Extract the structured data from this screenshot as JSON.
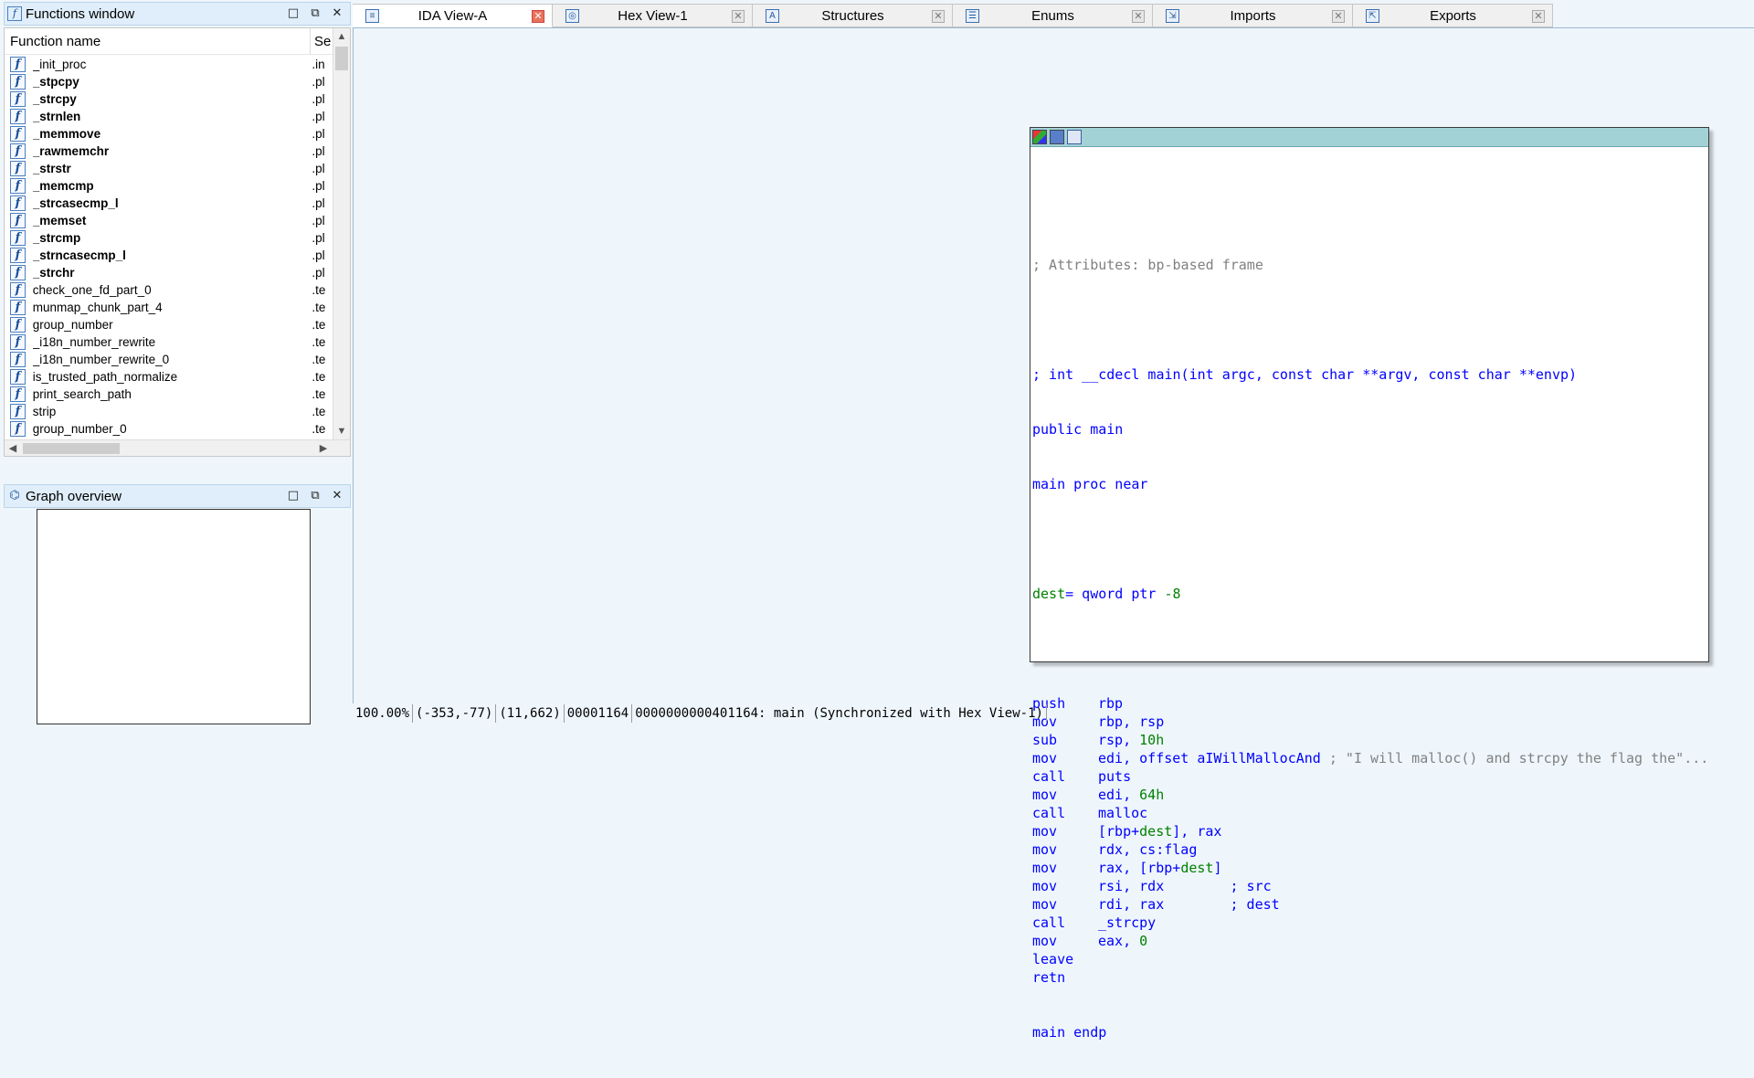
{
  "functions_window": {
    "title": "Functions window",
    "col_name": "Function name",
    "col_segment": "Se",
    "functions": [
      {
        "name": "_init_proc",
        "segment": ".in",
        "bold": false
      },
      {
        "name": "_stpcpy",
        "segment": ".pl",
        "bold": true
      },
      {
        "name": "_strcpy",
        "segment": ".pl",
        "bold": true
      },
      {
        "name": "_strnlen",
        "segment": ".pl",
        "bold": true
      },
      {
        "name": "_memmove",
        "segment": ".pl",
        "bold": true
      },
      {
        "name": "_rawmemchr",
        "segment": ".pl",
        "bold": true
      },
      {
        "name": "_strstr",
        "segment": ".pl",
        "bold": true
      },
      {
        "name": "_memcmp",
        "segment": ".pl",
        "bold": true
      },
      {
        "name": "_strcasecmp_l",
        "segment": ".pl",
        "bold": true
      },
      {
        "name": "_memset",
        "segment": ".pl",
        "bold": true
      },
      {
        "name": "_strcmp",
        "segment": ".pl",
        "bold": true
      },
      {
        "name": "_strncasecmp_l",
        "segment": ".pl",
        "bold": true
      },
      {
        "name": "_strchr",
        "segment": ".pl",
        "bold": true
      },
      {
        "name": "check_one_fd_part_0",
        "segment": ".te",
        "bold": false
      },
      {
        "name": "munmap_chunk_part_4",
        "segment": ".te",
        "bold": false
      },
      {
        "name": "group_number",
        "segment": ".te",
        "bold": false
      },
      {
        "name": "_i18n_number_rewrite",
        "segment": ".te",
        "bold": false
      },
      {
        "name": "_i18n_number_rewrite_0",
        "segment": ".te",
        "bold": false
      },
      {
        "name": "is_trusted_path_normalize",
        "segment": ".te",
        "bold": false
      },
      {
        "name": "print_search_path",
        "segment": ".te",
        "bold": false
      },
      {
        "name": "strip",
        "segment": ".te",
        "bold": false
      },
      {
        "name": "group_number_0",
        "segment": ".te",
        "bold": false
      }
    ]
  },
  "graph_overview": {
    "title": "Graph overview"
  },
  "window_controls": {
    "minimize": "□",
    "restore": "⧉",
    "close": "✕"
  },
  "tabs": [
    {
      "label": "IDA View-A",
      "icon": "ida-view-icon",
      "glyph": "≡",
      "active": true
    },
    {
      "label": "Hex View-1",
      "icon": "hex-view-icon",
      "glyph": "◎",
      "active": false
    },
    {
      "label": "Structures",
      "icon": "structures-icon",
      "glyph": "A",
      "active": false
    },
    {
      "label": "Enums",
      "icon": "enums-icon",
      "glyph": "☰",
      "active": false
    },
    {
      "label": "Imports",
      "icon": "imports-icon",
      "glyph": "⇲",
      "active": false
    },
    {
      "label": "Exports",
      "icon": "exports-icon",
      "glyph": "⇱",
      "active": false
    }
  ],
  "tab_close": "✕",
  "disassembly": {
    "attributes_comment": "; Attributes: bp-based frame",
    "prototype": "; int __cdecl main(int argc, const char **argv, const char **envp)",
    "public_line": "public main",
    "proc_line": "main proc near",
    "dest_var": "dest",
    "dest_def": "= qword ptr ",
    "dest_off": "-8",
    "instructions": [
      {
        "mn": "push",
        "ops": "rbp"
      },
      {
        "mn": "mov",
        "ops": "rbp, rsp"
      },
      {
        "mn": "sub",
        "ops": "rsp, ",
        "num": "10h"
      },
      {
        "mn": "mov",
        "ops": "edi, offset aIWillMallocAnd",
        "comment": " ; \"I will malloc() and strcpy the flag the\"..."
      },
      {
        "mn": "call",
        "ops": "puts"
      },
      {
        "mn": "mov",
        "ops": "edi, ",
        "num": "64h"
      },
      {
        "mn": "call",
        "ops": "malloc"
      },
      {
        "mn": "mov",
        "ops_pre": "[rbp+",
        "var": "dest",
        "ops_post": "], rax"
      },
      {
        "mn": "mov",
        "ops": "rdx, cs:flag"
      },
      {
        "mn": "mov",
        "ops_pre": "rax, [rbp+",
        "var": "dest",
        "ops_post": "]"
      },
      {
        "mn": "mov",
        "ops": "rsi, rdx        ; src"
      },
      {
        "mn": "mov",
        "ops": "rdi, rax        ; dest"
      },
      {
        "mn": "call",
        "ops": "_strcpy"
      },
      {
        "mn": "mov",
        "ops": "eax, ",
        "num": "0"
      },
      {
        "mn": "leave",
        "ops": ""
      },
      {
        "mn": "retn",
        "ops": ""
      }
    ],
    "endp_line": "main endp"
  },
  "status": {
    "zoom": "100.00%",
    "mouse": "(-353,-77)",
    "graph_pos": "(11,662)",
    "file_offset": "00001164",
    "address": "0000000000401164: main",
    "sync": "(Synchronized with Hex View-1)"
  }
}
